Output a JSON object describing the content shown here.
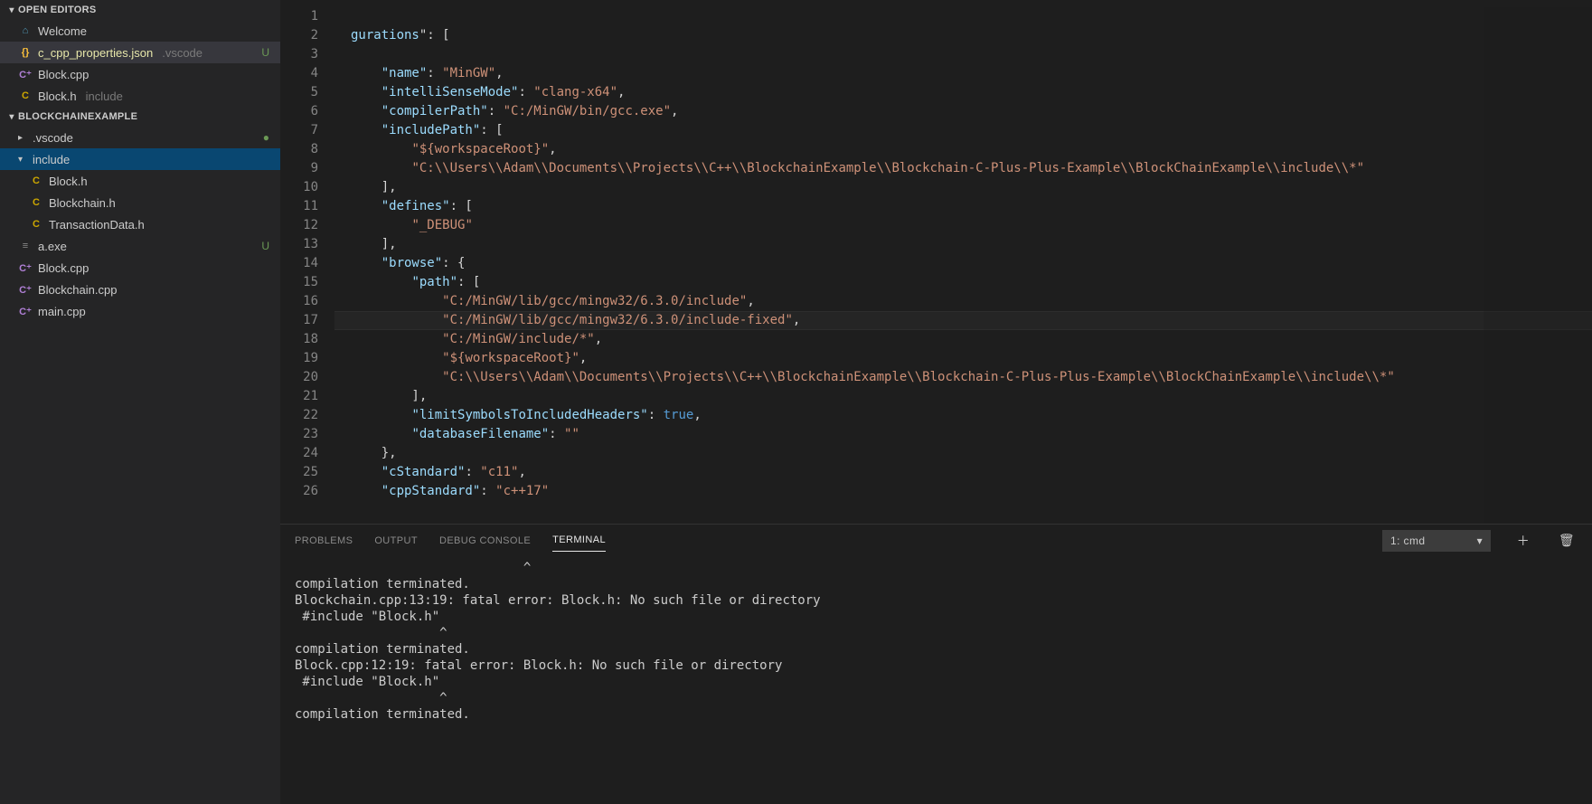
{
  "sidebar": {
    "openEditorsLabel": "OPEN EDITORS",
    "projectLabel": "BLOCKCHAINEXAMPLE",
    "openEditors": [
      {
        "icon": "vs",
        "name": "Welcome"
      },
      {
        "icon": "json",
        "name": "c_cpp_properties.json",
        "dim": ".vscode",
        "status": "U",
        "active": true
      },
      {
        "icon": "cpp",
        "name": "Block.cpp"
      },
      {
        "icon": "h",
        "name": "Block.h",
        "dim": "include"
      }
    ],
    "tree": [
      {
        "type": "folder",
        "name": ".vscode",
        "depth": 1,
        "open": false,
        "modified": true
      },
      {
        "type": "folder",
        "name": "include",
        "depth": 1,
        "open": true,
        "selected": true
      },
      {
        "type": "file",
        "icon": "h",
        "name": "Block.h",
        "depth": 2
      },
      {
        "type": "file",
        "icon": "h",
        "name": "Blockchain.h",
        "depth": 2
      },
      {
        "type": "file",
        "icon": "h",
        "name": "TransactionData.h",
        "depth": 2
      },
      {
        "type": "file",
        "icon": "exe",
        "name": "a.exe",
        "depth": 1,
        "status": "U"
      },
      {
        "type": "file",
        "icon": "cpp",
        "name": "Block.cpp",
        "depth": 1
      },
      {
        "type": "file",
        "icon": "cpp",
        "name": "Blockchain.cpp",
        "depth": 1
      },
      {
        "type": "file",
        "icon": "cpp",
        "name": "main.cpp",
        "depth": 1
      }
    ]
  },
  "editor": {
    "startLine": 1,
    "currentLine": 17,
    "lines": [
      [],
      [
        {
          "t": "gurations",
          "c": "s-key"
        },
        {
          "t": "\": [",
          "c": "s-punc"
        }
      ],
      [],
      [
        {
          "t": "    ",
          "c": ""
        },
        {
          "t": "\"name\"",
          "c": "s-key"
        },
        {
          "t": ": ",
          "c": "s-punc"
        },
        {
          "t": "\"MinGW\"",
          "c": "s-str"
        },
        {
          "t": ",",
          "c": "s-punc"
        }
      ],
      [
        {
          "t": "    ",
          "c": ""
        },
        {
          "t": "\"intelliSenseMode\"",
          "c": "s-key"
        },
        {
          "t": ": ",
          "c": "s-punc"
        },
        {
          "t": "\"clang-x64\"",
          "c": "s-str"
        },
        {
          "t": ",",
          "c": "s-punc"
        }
      ],
      [
        {
          "t": "    ",
          "c": ""
        },
        {
          "t": "\"compilerPath\"",
          "c": "s-key"
        },
        {
          "t": ": ",
          "c": "s-punc"
        },
        {
          "t": "\"C:/MinGW/bin/gcc.exe\"",
          "c": "s-str"
        },
        {
          "t": ",",
          "c": "s-punc"
        }
      ],
      [
        {
          "t": "    ",
          "c": ""
        },
        {
          "t": "\"includePath\"",
          "c": "s-key"
        },
        {
          "t": ": [",
          "c": "s-punc"
        }
      ],
      [
        {
          "t": "        ",
          "c": ""
        },
        {
          "t": "\"${workspaceRoot}\"",
          "c": "s-str"
        },
        {
          "t": ",",
          "c": "s-punc"
        }
      ],
      [
        {
          "t": "        ",
          "c": ""
        },
        {
          "t": "\"C:\\\\Users\\\\Adam\\\\Documents\\\\Projects\\\\C++\\\\BlockchainExample\\\\Blockchain-C-Plus-Plus-Example\\\\BlockChainExample\\\\include\\\\*\"",
          "c": "s-str"
        }
      ],
      [
        {
          "t": "    ],",
          "c": "s-punc"
        }
      ],
      [
        {
          "t": "    ",
          "c": ""
        },
        {
          "t": "\"defines\"",
          "c": "s-key"
        },
        {
          "t": ": [",
          "c": "s-punc"
        }
      ],
      [
        {
          "t": "        ",
          "c": ""
        },
        {
          "t": "\"_DEBUG\"",
          "c": "s-str"
        }
      ],
      [
        {
          "t": "    ],",
          "c": "s-punc"
        }
      ],
      [
        {
          "t": "    ",
          "c": ""
        },
        {
          "t": "\"browse\"",
          "c": "s-key"
        },
        {
          "t": ": {",
          "c": "s-punc"
        }
      ],
      [
        {
          "t": "        ",
          "c": ""
        },
        {
          "t": "\"path\"",
          "c": "s-key"
        },
        {
          "t": ": [",
          "c": "s-punc"
        }
      ],
      [
        {
          "t": "            ",
          "c": ""
        },
        {
          "t": "\"C:/MinGW/lib/gcc/mingw32/6.3.0/include\"",
          "c": "s-str"
        },
        {
          "t": ",",
          "c": "s-punc"
        }
      ],
      [
        {
          "t": "            ",
          "c": ""
        },
        {
          "t": "\"C:/MinGW/lib/gcc/mingw32/6.3.0/include-fixed\"",
          "c": "s-str"
        },
        {
          "t": ",",
          "c": "s-punc"
        }
      ],
      [
        {
          "t": "            ",
          "c": ""
        },
        {
          "t": "\"C:/MinGW/include/*\"",
          "c": "s-str"
        },
        {
          "t": ",",
          "c": "s-punc"
        }
      ],
      [
        {
          "t": "            ",
          "c": ""
        },
        {
          "t": "\"${workspaceRoot}\"",
          "c": "s-str"
        },
        {
          "t": ",",
          "c": "s-punc"
        }
      ],
      [
        {
          "t": "            ",
          "c": ""
        },
        {
          "t": "\"C:\\\\Users\\\\Adam\\\\Documents\\\\Projects\\\\C++\\\\BlockchainExample\\\\Blockchain-C-Plus-Plus-Example\\\\BlockChainExample\\\\include\\\\*\"",
          "c": "s-str"
        }
      ],
      [
        {
          "t": "        ],",
          "c": "s-punc"
        }
      ],
      [
        {
          "t": "        ",
          "c": ""
        },
        {
          "t": "\"limitSymbolsToIncludedHeaders\"",
          "c": "s-key"
        },
        {
          "t": ": ",
          "c": "s-punc"
        },
        {
          "t": "true",
          "c": "s-bool"
        },
        {
          "t": ",",
          "c": "s-punc"
        }
      ],
      [
        {
          "t": "        ",
          "c": ""
        },
        {
          "t": "\"databaseFilename\"",
          "c": "s-key"
        },
        {
          "t": ": ",
          "c": "s-punc"
        },
        {
          "t": "\"\"",
          "c": "s-str"
        }
      ],
      [
        {
          "t": "    },",
          "c": "s-punc"
        }
      ],
      [
        {
          "t": "    ",
          "c": ""
        },
        {
          "t": "\"cStandard\"",
          "c": "s-key"
        },
        {
          "t": ": ",
          "c": "s-punc"
        },
        {
          "t": "\"c11\"",
          "c": "s-str"
        },
        {
          "t": ",",
          "c": "s-punc"
        }
      ],
      [
        {
          "t": "    ",
          "c": ""
        },
        {
          "t": "\"cppStandard\"",
          "c": "s-key"
        },
        {
          "t": ": ",
          "c": "s-punc"
        },
        {
          "t": "\"c++17\"",
          "c": "s-str"
        }
      ]
    ]
  },
  "panel": {
    "tabs": {
      "problems": "PROBLEMS",
      "output": "OUTPUT",
      "debug": "DEBUG CONSOLE",
      "terminal": "TERMINAL"
    },
    "terminalSelector": "1: cmd",
    "terminalText": "                              ^\ncompilation terminated.\nBlockchain.cpp:13:19: fatal error: Block.h: No such file or directory\n #include \"Block.h\"\n                   ^\ncompilation terminated.\nBlock.cpp:12:19: fatal error: Block.h: No such file or directory\n #include \"Block.h\"\n                   ^\ncompilation terminated."
  },
  "icons": {
    "vs": "⌂",
    "json": "{}",
    "cpp": "C⁺",
    "h": "C",
    "exe": "≡",
    "plus": "＋",
    "trash": "🗑",
    "chev": "▾"
  }
}
